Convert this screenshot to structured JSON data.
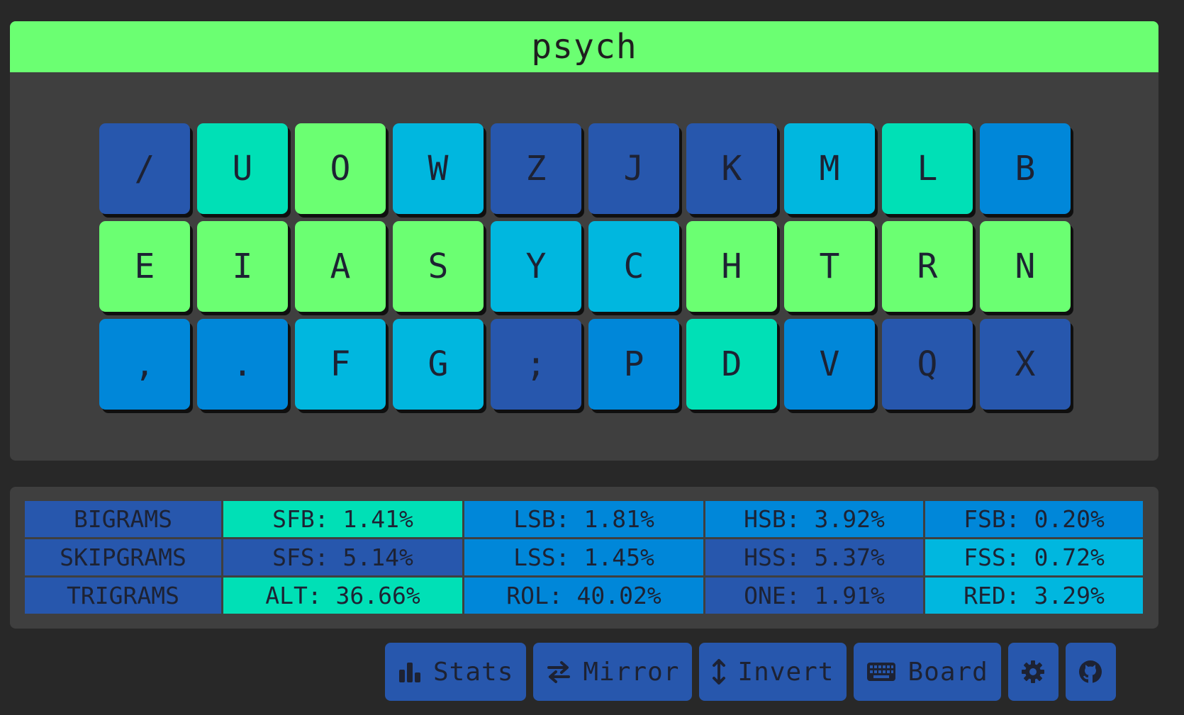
{
  "layout_name": "psych",
  "colors": {
    "page_bg": "#282828",
    "panel_bg": "#3f3f3f",
    "title_bg": "#6bff72",
    "text": "#1d2233",
    "heat": {
      "green": "#6bff72",
      "teal": "#00e0b6",
      "cyan": "#00b7df",
      "blue": "#0087d9",
      "navy": "#2757ad"
    }
  },
  "keyboard": {
    "rows": [
      [
        {
          "label": "/",
          "heat": "navy"
        },
        {
          "label": "U",
          "heat": "teal"
        },
        {
          "label": "O",
          "heat": "green"
        },
        {
          "label": "W",
          "heat": "cyan"
        },
        {
          "label": "Z",
          "heat": "navy"
        },
        {
          "label": "J",
          "heat": "navy"
        },
        {
          "label": "K",
          "heat": "navy"
        },
        {
          "label": "M",
          "heat": "cyan"
        },
        {
          "label": "L",
          "heat": "teal"
        },
        {
          "label": "B",
          "heat": "blue"
        }
      ],
      [
        {
          "label": "E",
          "heat": "green"
        },
        {
          "label": "I",
          "heat": "green"
        },
        {
          "label": "A",
          "heat": "green"
        },
        {
          "label": "S",
          "heat": "green"
        },
        {
          "label": "Y",
          "heat": "cyan"
        },
        {
          "label": "C",
          "heat": "cyan"
        },
        {
          "label": "H",
          "heat": "green"
        },
        {
          "label": "T",
          "heat": "green"
        },
        {
          "label": "R",
          "heat": "green"
        },
        {
          "label": "N",
          "heat": "green"
        }
      ],
      [
        {
          "label": ",",
          "heat": "blue"
        },
        {
          "label": ".",
          "heat": "blue"
        },
        {
          "label": "F",
          "heat": "cyan"
        },
        {
          "label": "G",
          "heat": "cyan"
        },
        {
          "label": ";",
          "heat": "navy"
        },
        {
          "label": "P",
          "heat": "blue"
        },
        {
          "label": "D",
          "heat": "teal"
        },
        {
          "label": "V",
          "heat": "blue"
        },
        {
          "label": "Q",
          "heat": "navy"
        },
        {
          "label": "X",
          "heat": "navy"
        }
      ]
    ]
  },
  "stats": {
    "rows": [
      {
        "header": "BIGRAMS",
        "cells": [
          {
            "text": "SFB: 1.41%",
            "heat": "teal"
          },
          {
            "text": "LSB: 1.81%",
            "heat": "blue"
          },
          {
            "text": "HSB: 3.92%",
            "heat": "blue"
          },
          {
            "text": "FSB: 0.20%",
            "heat": "blue"
          }
        ]
      },
      {
        "header": "SKIPGRAMS",
        "cells": [
          {
            "text": "SFS: 5.14%",
            "heat": "navy"
          },
          {
            "text": "LSS: 1.45%",
            "heat": "blue"
          },
          {
            "text": "HSS: 5.37%",
            "heat": "navy"
          },
          {
            "text": "FSS: 0.72%",
            "heat": "cyan"
          }
        ]
      },
      {
        "header": "TRIGRAMS",
        "cells": [
          {
            "text": "ALT: 36.66%",
            "heat": "teal"
          },
          {
            "text": "ROL: 40.02%",
            "heat": "blue"
          },
          {
            "text": "ONE: 1.91%",
            "heat": "navy"
          },
          {
            "text": "RED: 3.29%",
            "heat": "cyan"
          }
        ]
      }
    ]
  },
  "toolbar": [
    {
      "name": "stats-button",
      "icon": "bar-chart-icon",
      "label": "Stats"
    },
    {
      "name": "mirror-button",
      "icon": "swap-arrows-icon",
      "label": "Mirror"
    },
    {
      "name": "invert-button",
      "icon": "vertical-arrows-icon",
      "label": "Invert"
    },
    {
      "name": "board-button",
      "icon": "keyboard-icon",
      "label": "Board"
    },
    {
      "name": "settings-button",
      "icon": "gear-icon",
      "label": ""
    },
    {
      "name": "github-button",
      "icon": "github-icon",
      "label": ""
    }
  ]
}
